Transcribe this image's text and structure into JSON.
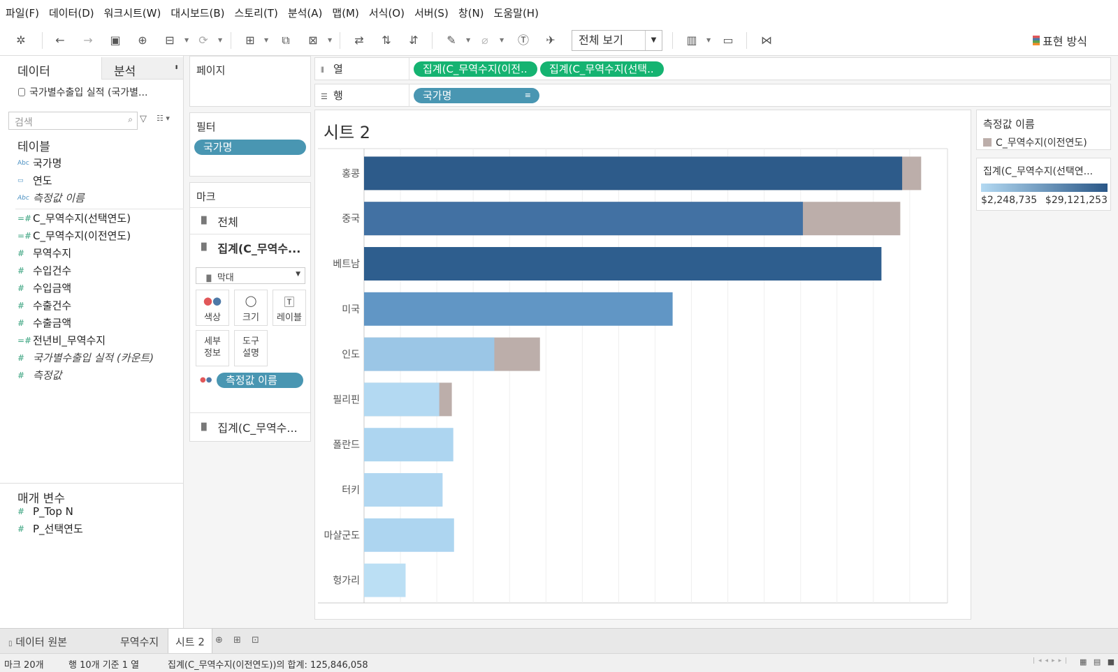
{
  "menu": [
    "파일(F)",
    "데이터(D)",
    "워크시트(W)",
    "대시보드(B)",
    "스토리(T)",
    "분석(A)",
    "맵(M)",
    "서식(O)",
    "서버(S)",
    "창(N)",
    "도움말(H)"
  ],
  "toolbar": {
    "fit_label": "전체 보기",
    "show_me_label": "표현 방식"
  },
  "data_pane": {
    "tab_data": "데이터",
    "tab_analysis": "분석",
    "datasource": "국가별수출입 실적 (국가별...",
    "search_placeholder": "검색",
    "tables_heading": "테이블",
    "dimensions": [
      {
        "name": "국가명",
        "icon": "Abc"
      },
      {
        "name": "연도",
        "icon": "calendar-icon"
      },
      {
        "name": "측정값 이름",
        "icon": "Abc",
        "italic": true
      }
    ],
    "measures": [
      {
        "name": "C_무역수지(선택연도)"
      },
      {
        "name": "C_무역수지(이전연도)"
      },
      {
        "name": "무역수지"
      },
      {
        "name": "수입건수"
      },
      {
        "name": "수입금액"
      },
      {
        "name": "수출건수"
      },
      {
        "name": "수출금액"
      },
      {
        "name": "전년비_무역수지"
      },
      {
        "name": "국가별수출입 실적 (카운트)",
        "italic": true
      },
      {
        "name": "측정값",
        "italic": true
      }
    ],
    "params_heading": "매개 변수",
    "parameters": [
      "P_Top N",
      "P_선택연도"
    ]
  },
  "pages_card": {
    "title": "페이지"
  },
  "filters_card": {
    "title": "필터",
    "pill": "국가명"
  },
  "marks_card": {
    "title": "마크",
    "all_label": "전체",
    "layer1_label": "집계(C_무역수...",
    "mark_type": "막대",
    "buttons": {
      "color": "색상",
      "size": "크기",
      "label": "레이블",
      "detail_1": "세부",
      "detail_2": "정보",
      "tooltip_1": "도구",
      "tooltip_2": "설명"
    },
    "color_pill": "측정값 이름",
    "layer2_label": "집계(C_무역수..."
  },
  "columns_shelf": {
    "label": "열",
    "pills": [
      "집계(C_무역수지(이전..",
      "집계(C_무역수지(선택.."
    ]
  },
  "rows_shelf": {
    "label": "행",
    "pills": [
      "국가명"
    ]
  },
  "sheet_title": "시트 2",
  "chart_data": {
    "type": "bar",
    "orientation": "horizontal",
    "categories": [
      "홍콩",
      "중국",
      "베트남",
      "미국",
      "인도",
      "필리핀",
      "폴란드",
      "터키",
      "마샬군도",
      "헝가리"
    ],
    "series": [
      {
        "name": "C_무역수지(선택연도)",
        "values": [
          29121253,
          23750000,
          28000000,
          16700000,
          7050000,
          4070000,
          4830000,
          4250000,
          4870000,
          2248735
        ],
        "colors": [
          "#2d5b8a",
          "#4271a3",
          "#2e5e8e",
          "#6196c5",
          "#9bc6e6",
          "#b3d9f2",
          "#add5f0",
          "#b1d7f1",
          "#add5f0",
          "#bbdff4"
        ]
      },
      {
        "name": "C_무역수지(이전연도)",
        "values": [
          30150000,
          29020000,
          null,
          null,
          9520000,
          4750000,
          null,
          null,
          null,
          null
        ],
        "color": "#bcaeaa"
      }
    ],
    "xlim": [
      0,
      31500000
    ],
    "grid": true
  },
  "legend_measure": {
    "title": "측정값 이름",
    "item": "C_무역수지(이전연도)",
    "color": "#bcaeaa"
  },
  "legend_color": {
    "title": "집계(C_무역수지(선택연...",
    "min": "$2,248,735",
    "max": "$29,121,253",
    "start_color": "#b3d9f2",
    "end_color": "#2a5787"
  },
  "sheet_tabs": {
    "datasource": "데이터 원본",
    "tabs": [
      "무역수지",
      "시트 2"
    ]
  },
  "status": {
    "marks": "마크 20개",
    "rows": "행 10개 기준 1 열",
    "sum": "집계(C_무역수지(이전연도))의 합계: 125,846,058"
  }
}
